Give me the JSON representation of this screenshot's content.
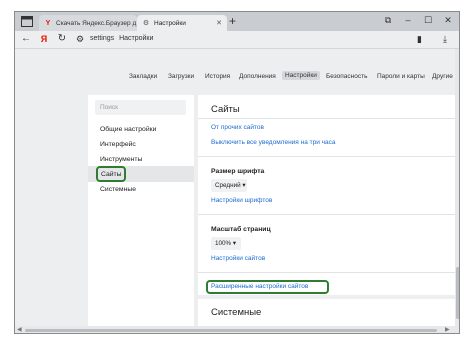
{
  "tabs": [
    {
      "label": "Скачать Яндекс.Браузер д",
      "favicon": "Y"
    },
    {
      "label": "Настройки",
      "favicon": "gear-icon"
    }
  ],
  "address": {
    "scheme_label": "settings",
    "page_label": "Настройки"
  },
  "top_nav": [
    "Закладки",
    "Загрузки",
    "История",
    "Дополнения",
    "Настройки",
    "Безопасность",
    "Пароли и карты",
    "Другие"
  ],
  "top_nav_selected": "Настройки",
  "sidebar": {
    "search_placeholder": "Поиск",
    "items": [
      "Общие настройки",
      "Интерфейс",
      "Инструменты",
      "Сайты",
      "Системные"
    ],
    "selected": "Сайты"
  },
  "panel": {
    "heading": "Сайты",
    "link_other_sites": "От прочих сайтов",
    "link_disable_notifications": "Выключить все уведомления на три часа",
    "font_size_label": "Размер шрифта",
    "font_size_value": "Средний",
    "font_settings_link": "Настройки шрифтов",
    "zoom_label": "Масштаб страниц",
    "zoom_value": "100%",
    "site_settings_link": "Настройки сайтов",
    "advanced_link": "Расширенные настройки сайтов",
    "next_heading": "Системные"
  },
  "colors": {
    "accent_link": "#1d6bcf",
    "highlight_border": "#2e7d32",
    "yandex_red": "#e61400"
  }
}
